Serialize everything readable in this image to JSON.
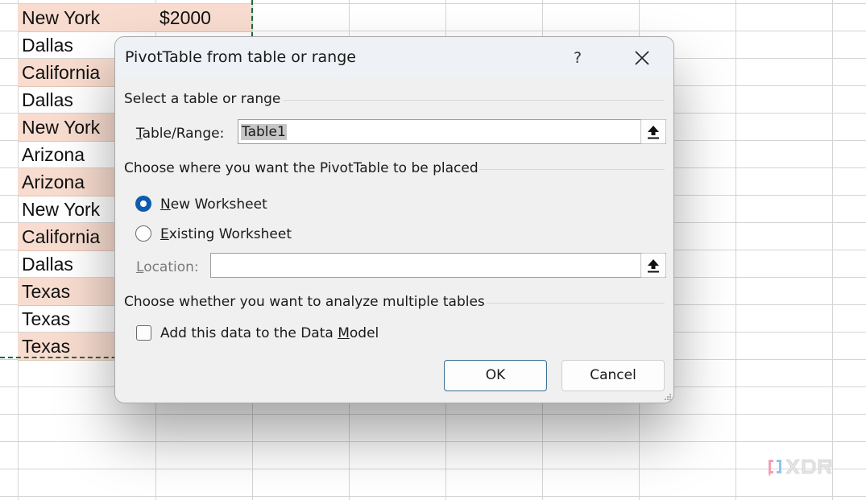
{
  "spreadsheet": {
    "rows": [
      {
        "city": "New York",
        "amount": "$2000",
        "shaded": true
      },
      {
        "city": "Dallas",
        "amount": "",
        "shaded": false
      },
      {
        "city": "California",
        "amount": "",
        "shaded": true
      },
      {
        "city": "Dallas",
        "amount": "",
        "shaded": false
      },
      {
        "city": "New York",
        "amount": "",
        "shaded": true
      },
      {
        "city": "Arizona",
        "amount": "",
        "shaded": false
      },
      {
        "city": "Arizona",
        "amount": "",
        "shaded": true
      },
      {
        "city": "New York",
        "amount": "",
        "shaded": false
      },
      {
        "city": "California",
        "amount": "",
        "shaded": true
      },
      {
        "city": "Dallas",
        "amount": "",
        "shaded": false
      },
      {
        "city": "Texas",
        "amount": "",
        "shaded": true
      },
      {
        "city": "Texas",
        "amount": "",
        "shaded": false
      },
      {
        "city": "Texas",
        "amount": "",
        "shaded": true
      }
    ],
    "selection_color": "#1e6b3c",
    "shade_color": "#f8dccf"
  },
  "dialog": {
    "title": "PivotTable from table or range",
    "help_label": "?",
    "close_icon": "close-icon",
    "section_source": "Select a table or range",
    "table_range_label_u": "T",
    "table_range_label_rest": "able/Range:",
    "table_range_value": "Table1",
    "section_placement": "Choose where you want the PivotTable to be placed",
    "radio_new_u": "N",
    "radio_new_rest": "ew Worksheet",
    "radio_new_selected": true,
    "radio_existing_u": "E",
    "radio_existing_rest": "xisting Worksheet",
    "radio_existing_selected": false,
    "location_label_u": "L",
    "location_label_rest": "ocation:",
    "location_value": "",
    "section_multiple": "Choose whether you want to analyze multiple tables",
    "checkbox_pre": "Add this data to the Data ",
    "checkbox_u": "M",
    "checkbox_post": "odel",
    "checkbox_checked": false,
    "ok_label": "OK",
    "cancel_label": "Cancel",
    "accent": "#0f5cae"
  },
  "watermark": {
    "text": "XDA"
  }
}
